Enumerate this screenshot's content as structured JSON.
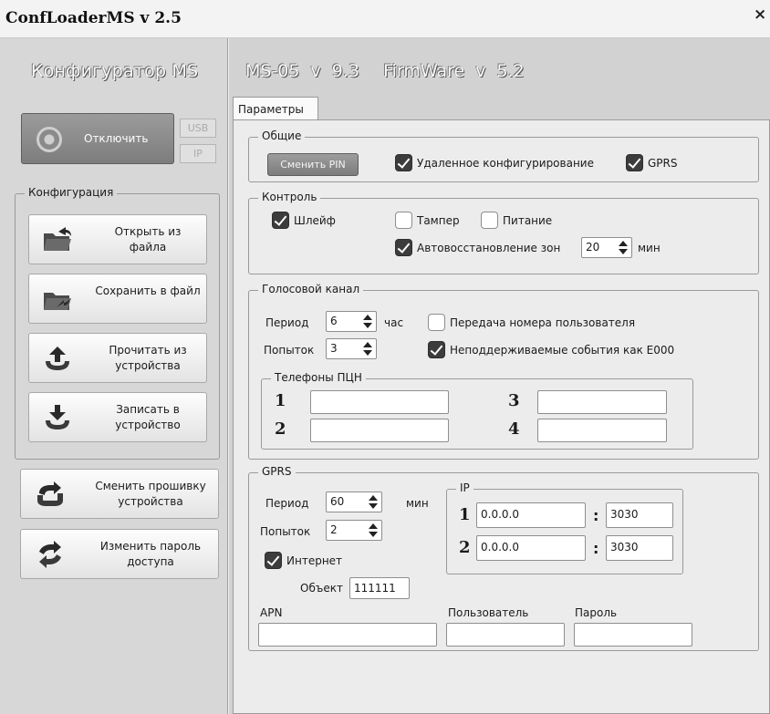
{
  "window": {
    "title": "ConfLoaderMS v 2.5",
    "close_glyph": "×"
  },
  "left": {
    "title": "Конфигуратор MS",
    "disconnect_label": "Отключить",
    "conn_usb": "USB",
    "conn_ip": "IP",
    "config_group": "Конфигурация",
    "buttons": [
      {
        "label": "Открыть из файла",
        "icon": "folder-open-icon"
      },
      {
        "label": "Сохранить в файл",
        "icon": "folder-save-icon"
      },
      {
        "label": "Прочитать из устройства",
        "icon": "upload-arrow-icon"
      },
      {
        "label": "Записать в устройство",
        "icon": "download-arrow-icon"
      }
    ],
    "firmware_btn": "Сменить прошивку устройства",
    "password_btn": "Изменить пароль доступа"
  },
  "main": {
    "device": "MS-05 v 9.3",
    "firmware": "FirmWare v 5.2",
    "tab": "Параметры",
    "general": {
      "legend": "Общие",
      "pin_btn": "Сменить PIN",
      "remote_cfg": "Удаленное конфигурирование",
      "remote_cfg_checked": true,
      "gprs": "GPRS",
      "gprs_checked": true
    },
    "control": {
      "legend": "Контроль",
      "loop": "Шлейф",
      "loop_checked": true,
      "tamper": "Тампер",
      "tamper_checked": false,
      "power": "Питание",
      "power_checked": false,
      "autorestore": "Автовосстановление зон",
      "autorestore_checked": true,
      "autorestore_value": "20",
      "autorestore_unit": "мин"
    },
    "voice": {
      "legend": "Голосовой канал",
      "period_label": "Период",
      "period_value": "6",
      "period_unit": "час",
      "attempts_label": "Попыток",
      "attempts_value": "3",
      "send_user": "Передача номера пользователя",
      "send_user_checked": false,
      "unsupported": "Неподдерживаемые события как E000",
      "unsupported_checked": true,
      "phones_legend": "Телефоны ПЦН",
      "phones": [
        {
          "num": "1",
          "value": ""
        },
        {
          "num": "3",
          "value": ""
        },
        {
          "num": "2",
          "value": ""
        },
        {
          "num": "4",
          "value": ""
        }
      ]
    },
    "gprs": {
      "legend": "GPRS",
      "period_label": "Период",
      "period_value": "60",
      "period_unit": "мин",
      "attempts_label": "Попыток",
      "attempts_value": "2",
      "internet": "Интернет",
      "internet_checked": true,
      "object_label": "Объект",
      "object_value": "111111",
      "ip_legend": "IP",
      "ips": [
        {
          "num": "1",
          "addr": "0.0.0.0",
          "port": "3030"
        },
        {
          "num": "2",
          "addr": "0.0.0.0",
          "port": "3030"
        }
      ],
      "colon": ":",
      "apn_label": "APN",
      "apn_value": "",
      "user_label": "Пользователь",
      "user_value": "",
      "password_label": "Пароль",
      "password_value": ""
    }
  }
}
